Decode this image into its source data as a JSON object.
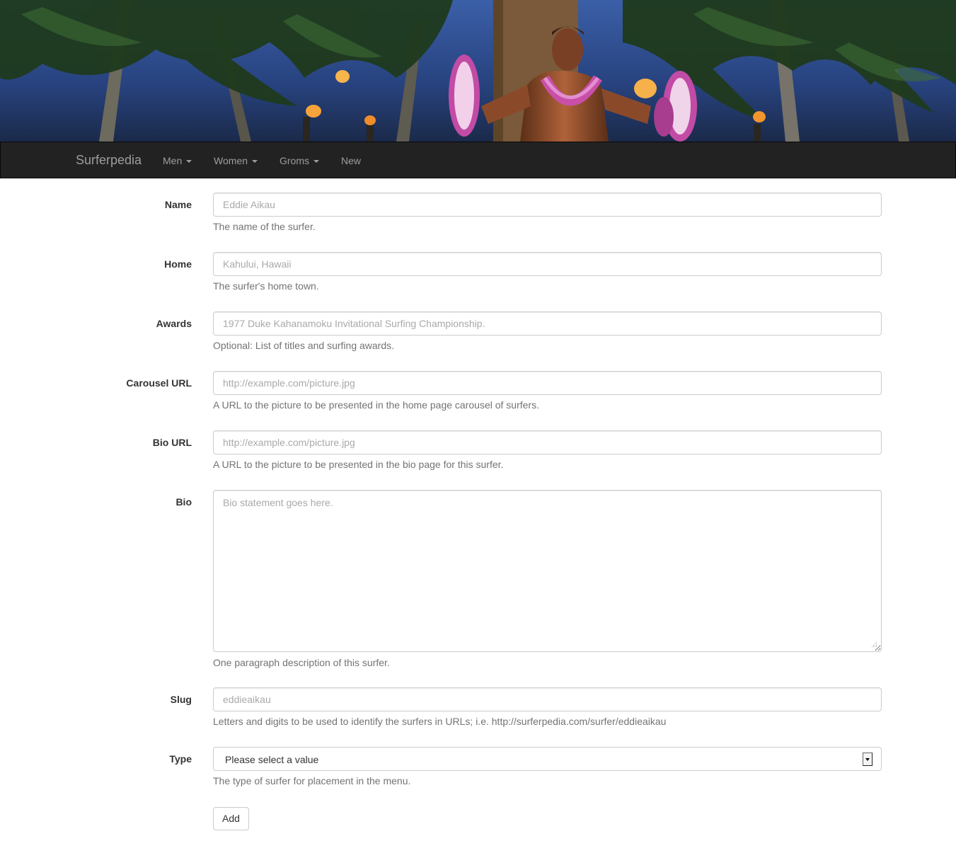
{
  "navbar": {
    "brand": "Surferpedia",
    "items": [
      {
        "label": "Men",
        "dropdown": true
      },
      {
        "label": "Women",
        "dropdown": true
      },
      {
        "label": "Groms",
        "dropdown": true
      },
      {
        "label": "New",
        "dropdown": false
      }
    ]
  },
  "form": {
    "name": {
      "label": "Name",
      "placeholder": "Eddie Aikau",
      "value": "",
      "help": "The name of the surfer."
    },
    "home": {
      "label": "Home",
      "placeholder": "Kahului, Hawaii",
      "value": "",
      "help": "The surfer's home town."
    },
    "awards": {
      "label": "Awards",
      "placeholder": "1977 Duke Kahanamoku Invitational Surfing Championship.",
      "value": "",
      "help": "Optional: List of titles and surfing awards."
    },
    "carousel_url": {
      "label": "Carousel URL",
      "placeholder": "http://example.com/picture.jpg",
      "value": "",
      "help": "A URL to the picture to be presented in the home page carousel of surfers."
    },
    "bio_url": {
      "label": "Bio URL",
      "placeholder": "http://example.com/picture.jpg",
      "value": "",
      "help": "A URL to the picture to be presented in the bio page for this surfer."
    },
    "bio": {
      "label": "Bio",
      "placeholder": "Bio statement goes here.",
      "value": "",
      "help": "One paragraph description of this surfer."
    },
    "slug": {
      "label": "Slug",
      "placeholder": "eddieaikau",
      "value": "",
      "help": "Letters and digits to be used to identify the surfers in URLs; i.e. http://surferpedia.com/surfer/eddieaikau"
    },
    "type": {
      "label": "Type",
      "selected": "Please select a value",
      "help": "The type of surfer for placement in the menu."
    },
    "submit_label": "Add"
  },
  "colors": {
    "navbar_bg": "#222222",
    "navbar_text": "#9d9d9d",
    "help_text": "#737373"
  }
}
